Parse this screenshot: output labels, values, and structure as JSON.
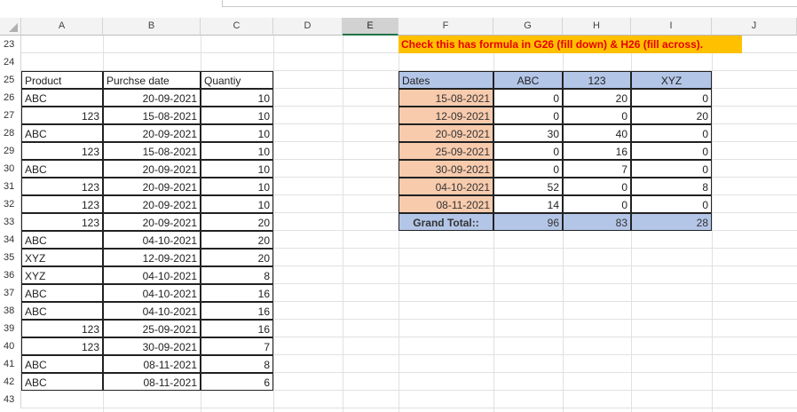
{
  "columns": [
    "A",
    "B",
    "C",
    "D",
    "E",
    "F",
    "G",
    "H",
    "I",
    "J"
  ],
  "selected_column": "E",
  "rows": [
    "23",
    "24",
    "25",
    "26",
    "27",
    "28",
    "29",
    "30",
    "31",
    "32",
    "33",
    "34",
    "35",
    "36",
    "37",
    "38",
    "39",
    "40",
    "41",
    "42",
    "43"
  ],
  "banner_text": "Check this has formula in G26 (fill down) & H26 (fill across).",
  "source_table": {
    "headers": [
      "Product",
      "Purchse date",
      "Quantiy"
    ],
    "rows": [
      [
        "ABC",
        "20-09-2021",
        "10"
      ],
      [
        "123",
        "15-08-2021",
        "10"
      ],
      [
        "ABC",
        "20-09-2021",
        "10"
      ],
      [
        "123",
        "15-08-2021",
        "10"
      ],
      [
        "ABC",
        "20-09-2021",
        "10"
      ],
      [
        "123",
        "20-09-2021",
        "10"
      ],
      [
        "123",
        "20-09-2021",
        "10"
      ],
      [
        "123",
        "20-09-2021",
        "20"
      ],
      [
        "ABC",
        "04-10-2021",
        "20"
      ],
      [
        "XYZ",
        "12-09-2021",
        "20"
      ],
      [
        "XYZ",
        "04-10-2021",
        "8"
      ],
      [
        "ABC",
        "04-10-2021",
        "16"
      ],
      [
        "ABC",
        "04-10-2021",
        "16"
      ],
      [
        "123",
        "25-09-2021",
        "16"
      ],
      [
        "123",
        "30-09-2021",
        "7"
      ],
      [
        "ABC",
        "08-11-2021",
        "8"
      ],
      [
        "ABC",
        "08-11-2021",
        "6"
      ]
    ]
  },
  "pivot_table": {
    "headers": [
      "Dates",
      "ABC",
      "123",
      "XYZ"
    ],
    "rows": [
      [
        "15-08-2021",
        "0",
        "20",
        "0"
      ],
      [
        "12-09-2021",
        "0",
        "0",
        "20"
      ],
      [
        "20-09-2021",
        "30",
        "40",
        "0"
      ],
      [
        "25-09-2021",
        "0",
        "16",
        "0"
      ],
      [
        "30-09-2021",
        "0",
        "7",
        "0"
      ],
      [
        "04-10-2021",
        "52",
        "0",
        "8"
      ],
      [
        "08-11-2021",
        "14",
        "0",
        "0"
      ]
    ],
    "total": [
      "Grand Total::",
      "96",
      "83",
      "28"
    ]
  },
  "colors": {
    "banner_bg": "#ffc000",
    "banner_text": "#e60000",
    "pivot_header_bg": "#b4c6e7",
    "pivot_date_bg": "#f8cbad",
    "selected_header_bg": "#d2d2d2"
  }
}
